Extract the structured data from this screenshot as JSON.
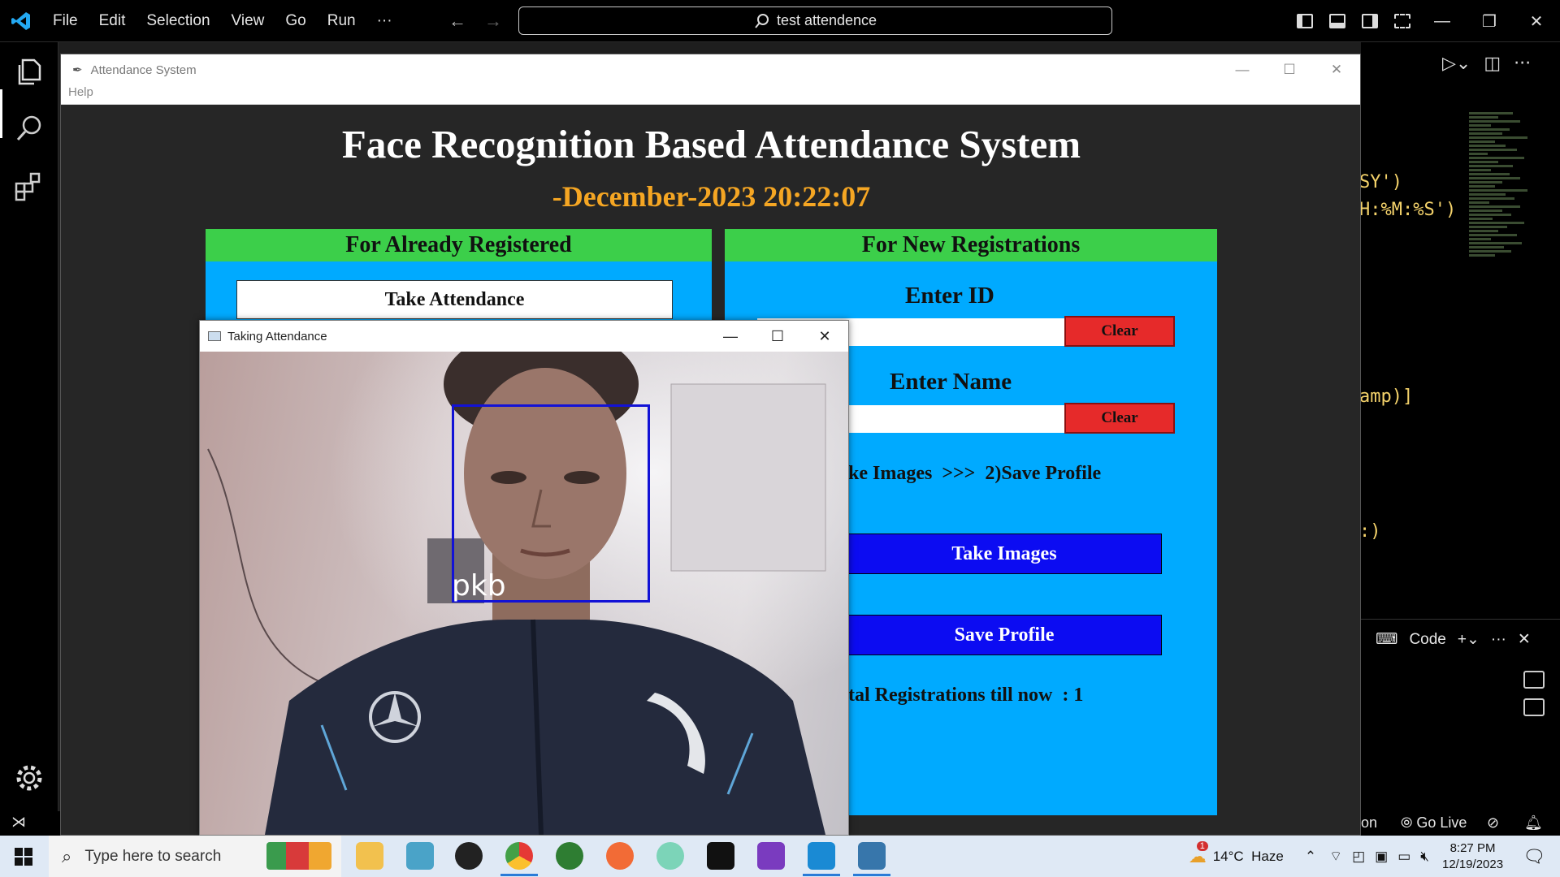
{
  "vscode": {
    "menu": [
      "File",
      "Edit",
      "Selection",
      "View",
      "Go",
      "Run",
      "···"
    ],
    "search_text": "test attendence",
    "code_fragments": [
      "SY')",
      "H:%M:%S')",
      "amp)]",
      ":)"
    ],
    "panel_label": "Code",
    "status_left": "on",
    "status_golive": "Go Live",
    "colors": {
      "background": "#000000",
      "code_string": "#f5d36b"
    }
  },
  "attendance_window": {
    "title": "Attendance System",
    "menu": "Help",
    "heading": "Face Recognition Based Attendance System",
    "clock": "-December-2023 20:22:07",
    "left_frame": {
      "header": "For Already Registered",
      "take_attendance_button": "Take Attendance"
    },
    "right_frame": {
      "header": "For New Registrations",
      "id_label": "Enter ID",
      "id_clear": "Clear",
      "name_label": "Enter Name",
      "name_clear": "Clear",
      "steps_text": "ake Images  >>>  2)Save Profile",
      "take_images_button": "Take Images",
      "save_profile_button": "Save Profile",
      "registrations_text": "otal Registrations till now  : 1"
    },
    "colors": {
      "frame_bg": "#00aaff",
      "header_bg": "#3ccf4a",
      "clear_bg": "#e62a2a",
      "action_bg": "#0c0cf2",
      "clock": "#f5a623"
    }
  },
  "camera_window": {
    "title": "Taking Attendance",
    "face_label": "pkb",
    "box_color": "#1212d6"
  },
  "taskbar": {
    "search_placeholder": "Type here to search",
    "weather": "14°C  Haze",
    "weather_badge": "1",
    "time": "8:27 PM",
    "date": "12/19/2023"
  }
}
